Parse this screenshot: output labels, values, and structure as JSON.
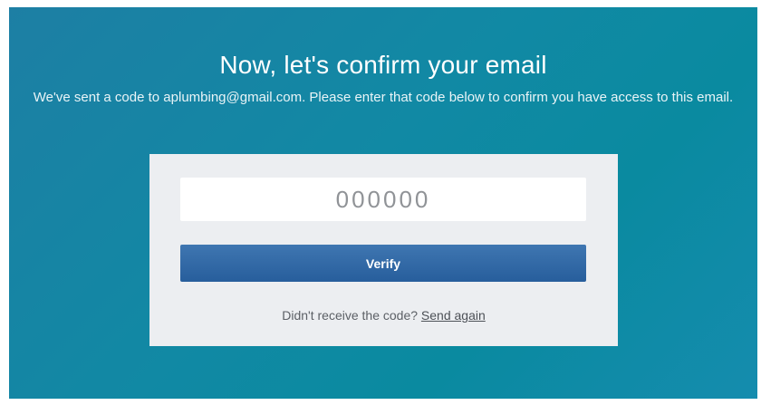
{
  "header": {
    "title": "Now, let's confirm your email",
    "subtitle": "We've sent a code to aplumbing@gmail.com. Please enter that code below to confirm you have access to this email."
  },
  "form": {
    "code_placeholder": "000000",
    "verify_label": "Verify",
    "resend_prompt": "Didn't receive the code?",
    "resend_link": "Send again"
  },
  "colors": {
    "background": "#1189a4",
    "card": "#eceef1",
    "button": "#2f67a5"
  }
}
